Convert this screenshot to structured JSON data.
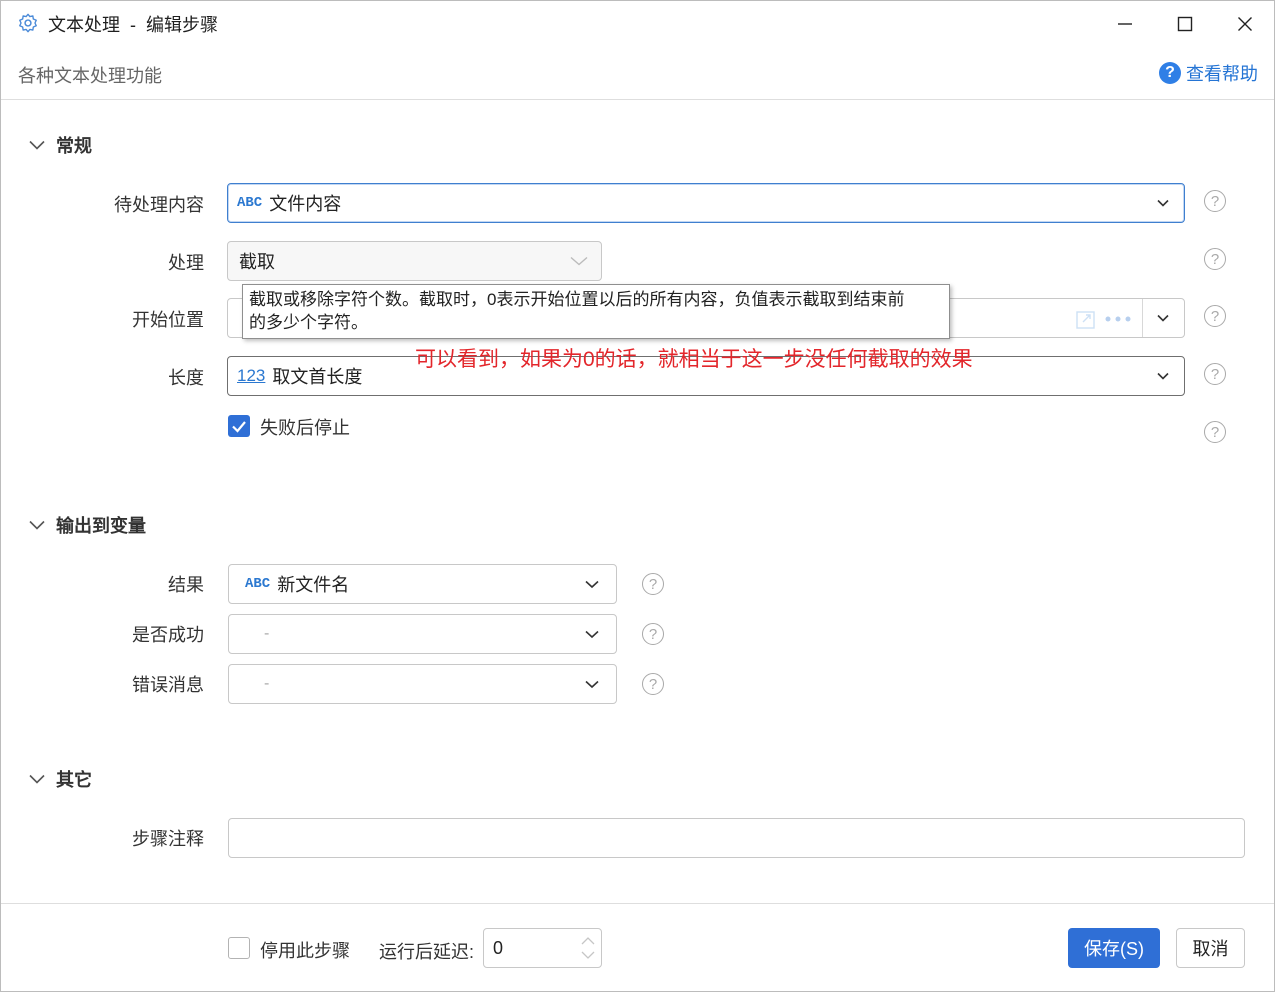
{
  "window": {
    "title": "文本处理  -  编辑步骤",
    "subtitle": "各种文本处理功能",
    "help_link": "查看帮助"
  },
  "sections": {
    "general": "常规",
    "output": "输出到变量",
    "other": "其它"
  },
  "general": {
    "content_label": "待处理内容",
    "content_type": "ABC",
    "content_value": "文件内容",
    "process_label": "处理",
    "process_value": "截取",
    "start_label": "开始位置",
    "length_label": "长度",
    "length_type": "123",
    "length_value": "取文首长度",
    "stop_on_fail": "失败后停止",
    "stop_on_fail_checked": true
  },
  "tooltip": {
    "line1": "截取或移除字符个数。截取时，0表示开始位置以后的所有内容，负值表示截取到结束前",
    "line2": "的多少个字符。"
  },
  "annotation": "可以看到，如果为0的话，就相当于这一步没任何截取的效果",
  "output": {
    "result_label": "结果",
    "result_type": "ABC",
    "result_value": "新文件名",
    "success_label": "是否成功",
    "success_value": "-",
    "error_label": "错误消息",
    "error_value": "-"
  },
  "other": {
    "note_label": "步骤注释",
    "note_value": ""
  },
  "footer": {
    "disable_label": "停用此步骤",
    "disable_checked": false,
    "delay_label": "运行后延迟:",
    "delay_value": "0",
    "save": "保存(S)",
    "cancel": "取消"
  },
  "colors": {
    "accent": "#2f6fd6",
    "link": "#2474d4",
    "annotation": "#e3262b"
  }
}
